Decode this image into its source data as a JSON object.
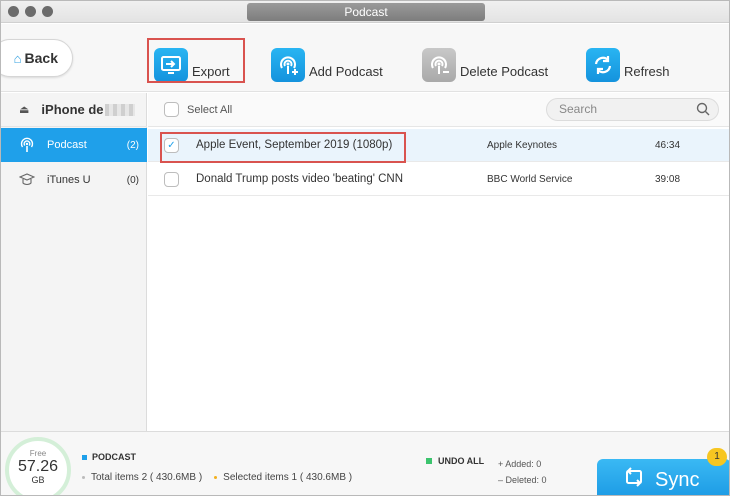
{
  "window": {
    "title": "Podcast"
  },
  "toolbar": {
    "back_label": "Back",
    "export_label": "Export",
    "add_label": "Add Podcast",
    "delete_label": "Delete Podcast",
    "refresh_label": "Refresh"
  },
  "sidebar": {
    "device_name": "iPhone de",
    "items": [
      {
        "label": "Podcast",
        "count": "(2)"
      },
      {
        "label": "iTunes U",
        "count": "(0)"
      }
    ]
  },
  "list": {
    "select_all_label": "Select All",
    "search_placeholder": "Search",
    "rows": [
      {
        "name": "Apple Event, September 2019 (1080p)",
        "artist": "Apple Keynotes",
        "duration": "46:34",
        "checked": true
      },
      {
        "name": "Donald Trump posts video 'beating' CNN",
        "artist": "BBC World Service",
        "duration": "39:08",
        "checked": false
      }
    ]
  },
  "footer": {
    "free_label": "Free",
    "free_value": "57.26",
    "free_unit": "GB",
    "category_label": "PODCAST",
    "total_items": "Total items 2 ( 430.6MB )",
    "selected_items": "Selected items 1 ( 430.6MB )",
    "undo_label": "UNDO ALL",
    "added": "Added: 0",
    "deleted": "Deleted: 0",
    "sync_label": "Sync",
    "sync_badge": "1"
  },
  "colors": {
    "accent": "#1fa0ea",
    "highlight": "#d9534f",
    "undo_green": "#3cc46e",
    "badge": "#f7c621"
  },
  "icons": {
    "export": "export-icon",
    "add": "add-podcast-icon",
    "delete": "delete-podcast-icon",
    "refresh": "refresh-icon",
    "sync": "sync-icon"
  }
}
